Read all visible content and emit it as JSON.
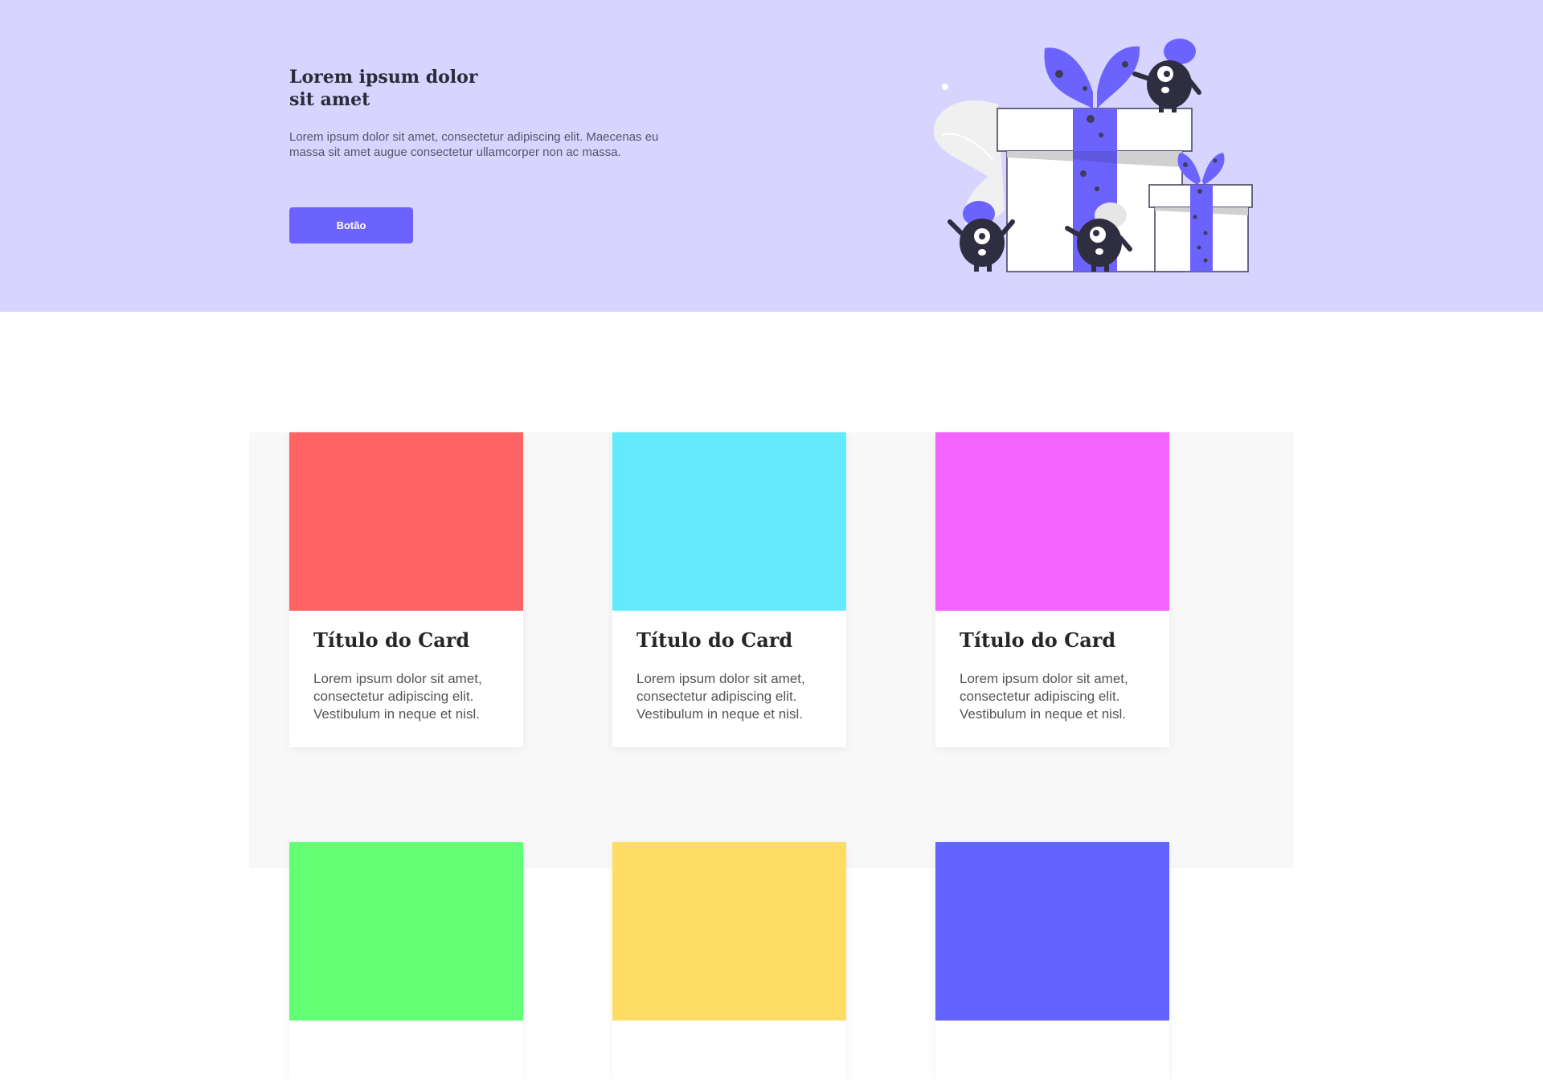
{
  "hero": {
    "title": "Lorem ipsum dolor sit amet",
    "text": "Lorem ipsum dolor sit amet, consectetur adipiscing elit. Maecenas eu massa sit amet augue consectetur ullamcorper non ac massa.",
    "button_label": "Botão",
    "illustration": "gift-boxes-monsters-illustration",
    "colors": {
      "background": "#d7d5ff",
      "accent": "#6c63ff",
      "monster": "#2f2e41"
    }
  },
  "cards": [
    {
      "title": "Título do Card",
      "text": "Lorem ipsum dolor sit amet, consectetur adipiscing elit. Vestibulum in neque et nisl.",
      "color": "#ff6363"
    },
    {
      "title": "Título do Card",
      "text": "Lorem ipsum dolor sit amet, consectetur adipiscing elit. Vestibulum in neque et nisl.",
      "color": "#63ebfc"
    },
    {
      "title": "Título do Card",
      "text": "Lorem ipsum dolor sit amet, consectetur adipiscing elit. Vestibulum in neque et nisl.",
      "color": "#f263ff"
    },
    {
      "title": "",
      "text": "",
      "color": "#63ff75"
    },
    {
      "title": "",
      "text": "",
      "color": "#ffdc63"
    },
    {
      "title": "",
      "text": "",
      "color": "#6363ff"
    }
  ],
  "colors": {
    "cards_background": "#f8f8f8"
  }
}
